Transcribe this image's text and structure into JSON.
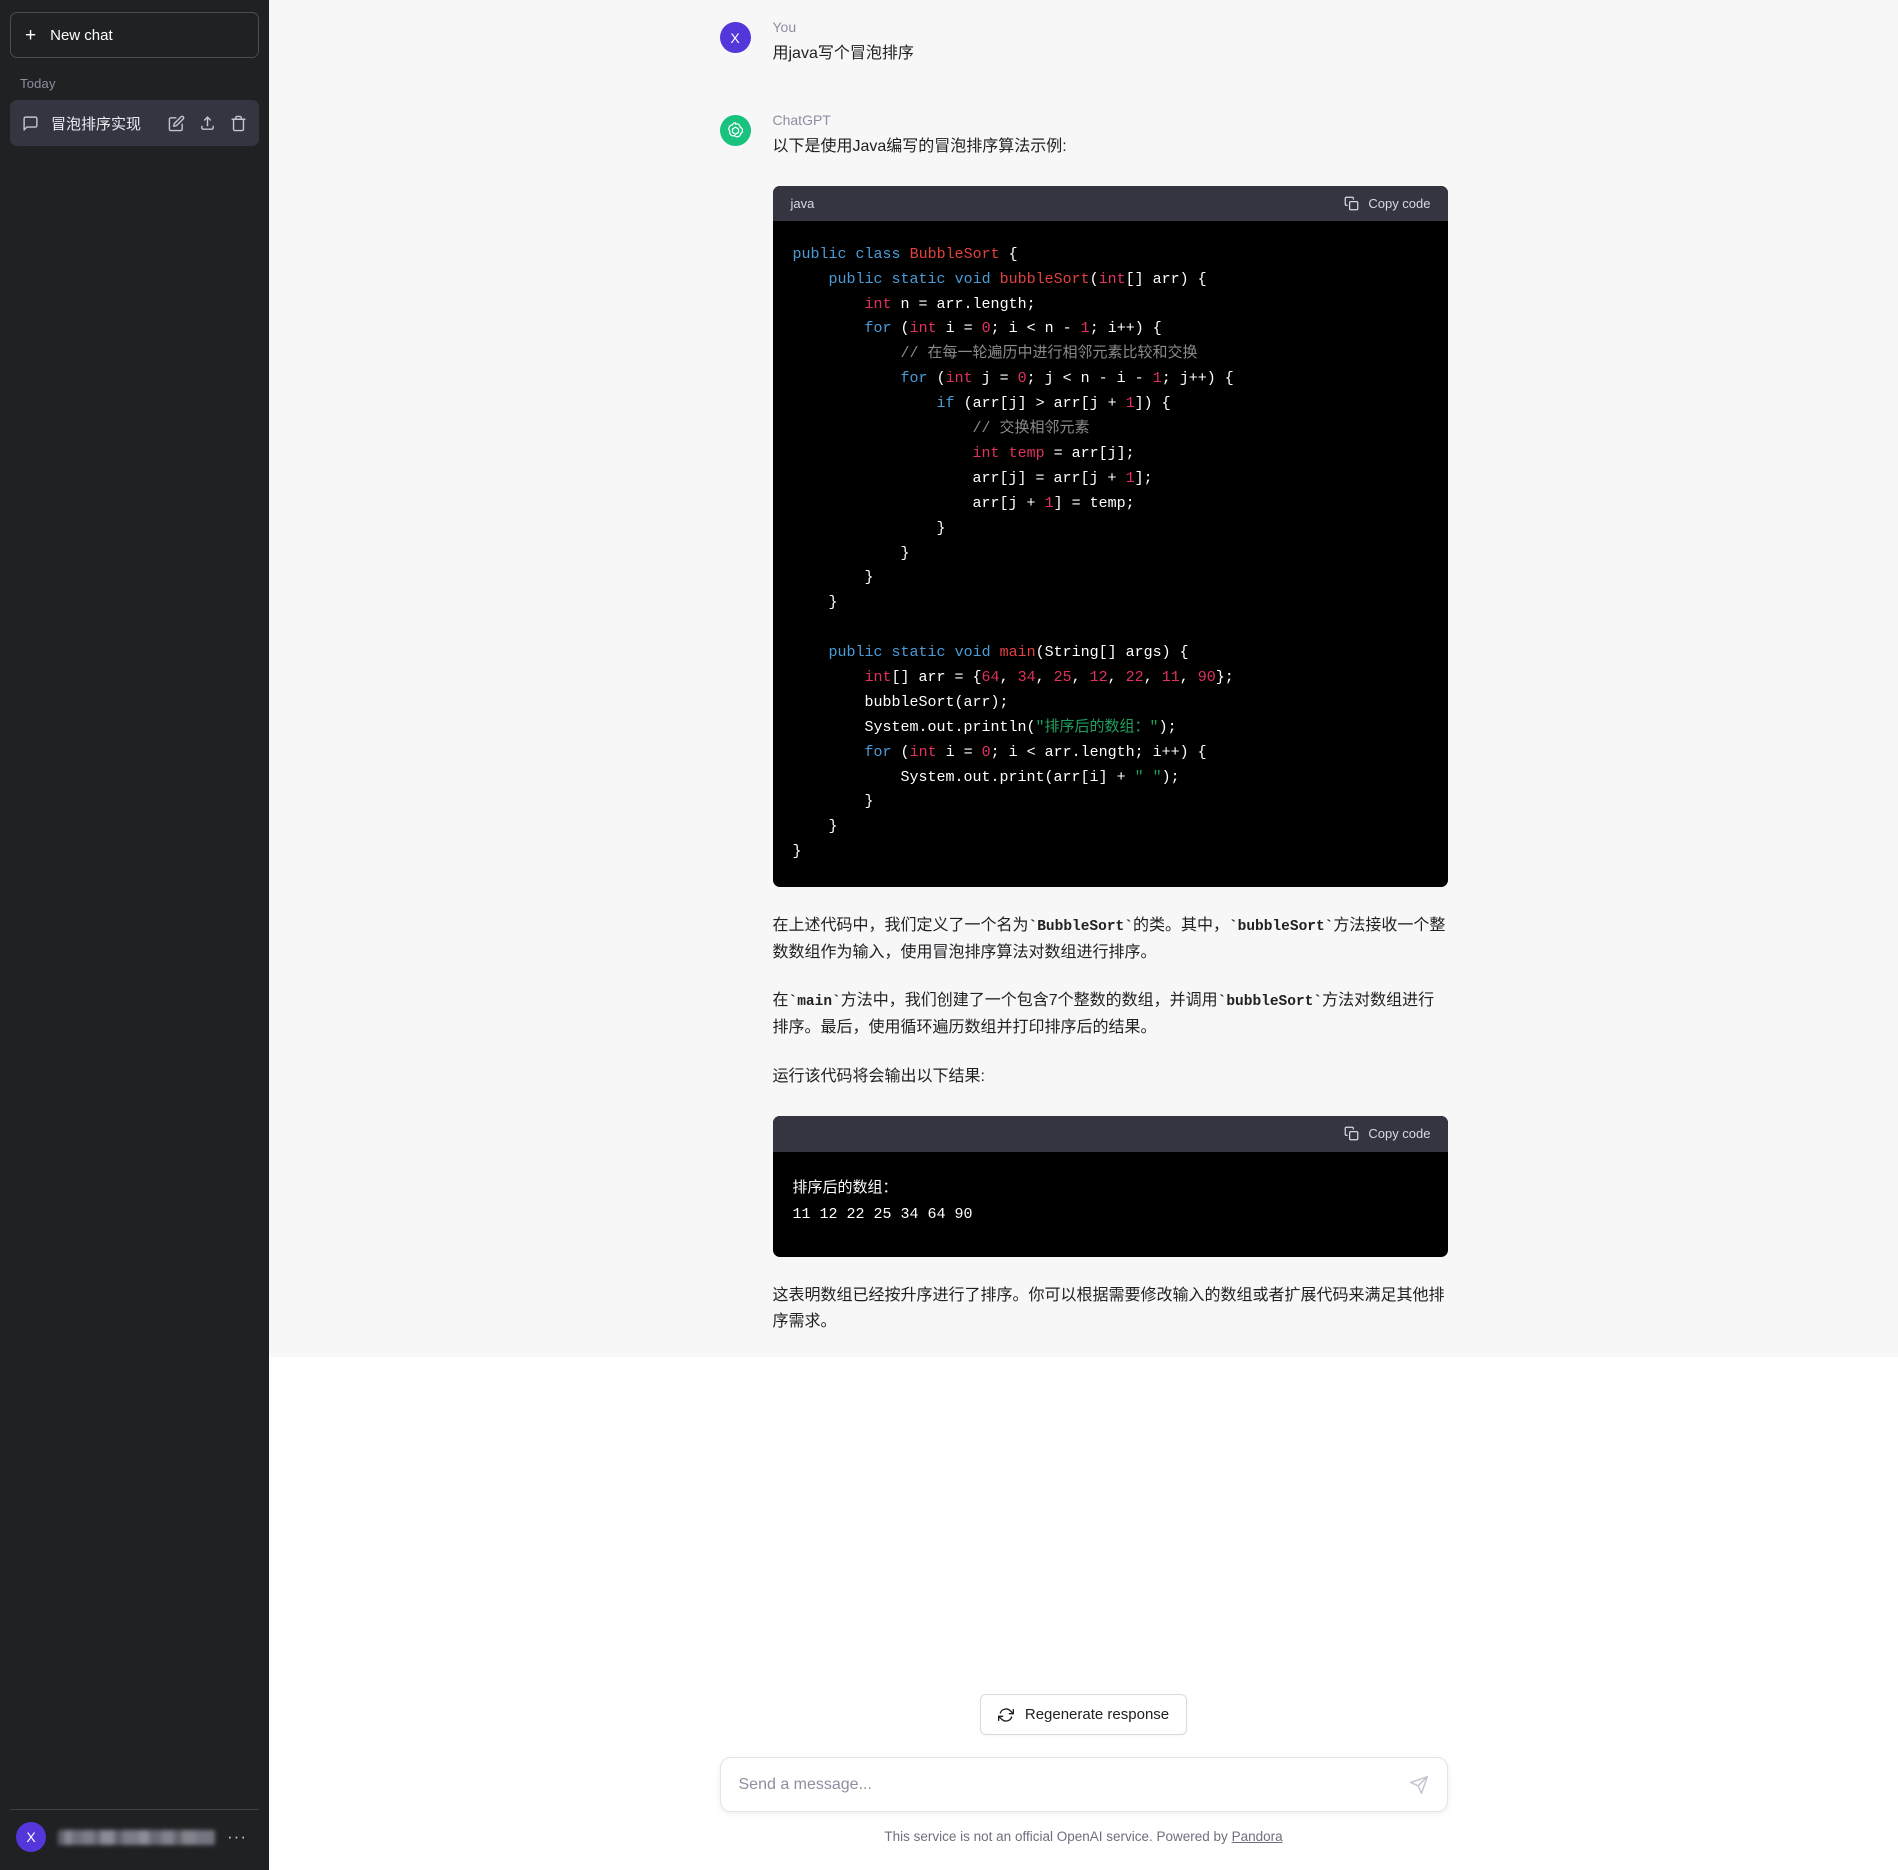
{
  "sidebar": {
    "new_chat_label": "New chat",
    "section_label": "Today",
    "chat_title": "冒泡排序实现",
    "user_avatar_initial": "X",
    "more_dots": "···"
  },
  "conversation": {
    "user": {
      "role": "You",
      "avatar_initial": "X",
      "text": "用java写个冒泡排序"
    },
    "assistant": {
      "role": "ChatGPT",
      "intro": "以下是使用Java编写的冒泡排序算法示例:",
      "paragraph_1_a": "在上述代码中，我们定义了一个名为",
      "paragraph_1_code": "`BubbleSort`",
      "paragraph_1_b": "的类。其中，",
      "paragraph_1_code2": "`bubbleSort`",
      "paragraph_1_c": "方法接收一个整数数组作为输入，使用冒泡排序算法对数组进行排序。",
      "paragraph_2_a": "在",
      "paragraph_2_code": "`main`",
      "paragraph_2_b": "方法中，我们创建了一个包含7个整数的数组，并调用",
      "paragraph_2_code2": "`bubbleSort`",
      "paragraph_2_c": "方法对数组进行排序。最后，使用循环遍历数组并打印排序后的结果。",
      "paragraph_3": "运行该代码将会输出以下结果:",
      "paragraph_4": "这表明数组已经按升序进行了排序。你可以根据需要修改输入的数组或者扩展代码来满足其他排序需求。"
    }
  },
  "code_block": {
    "language": "java",
    "copy_label": "Copy code",
    "array_values": [
      64,
      34,
      25,
      12,
      22,
      11,
      90
    ],
    "comment_1": "// 在每一轮遍历中进行相邻元素比较和交换",
    "comment_2": "// 交换相邻元素",
    "string_1": "\"排序后的数组：\"",
    "class_name": "BubbleSort",
    "method_name": "bubbleSort",
    "main_name": "main"
  },
  "output_block": {
    "copy_label": "Copy code",
    "line_1": "排序后的数组：",
    "line_2": "11 12 22 25 34 64 90",
    "sorted_values": [
      11,
      12,
      22,
      25,
      34,
      64,
      90
    ]
  },
  "bottom": {
    "regenerate_label": "Regenerate response",
    "composer_placeholder": "Send a message...",
    "composer_value": "",
    "footnote_text": "This service is not an official OpenAI service. Powered by ",
    "footnote_link": "Pandora"
  },
  "colors": {
    "sidebar_bg": "#202123",
    "accent_purple": "#5436da",
    "accent_green": "#19c37d",
    "code_bg": "#000000",
    "code_header_bg": "#343541",
    "turn_bg": "#f7f7f8"
  }
}
